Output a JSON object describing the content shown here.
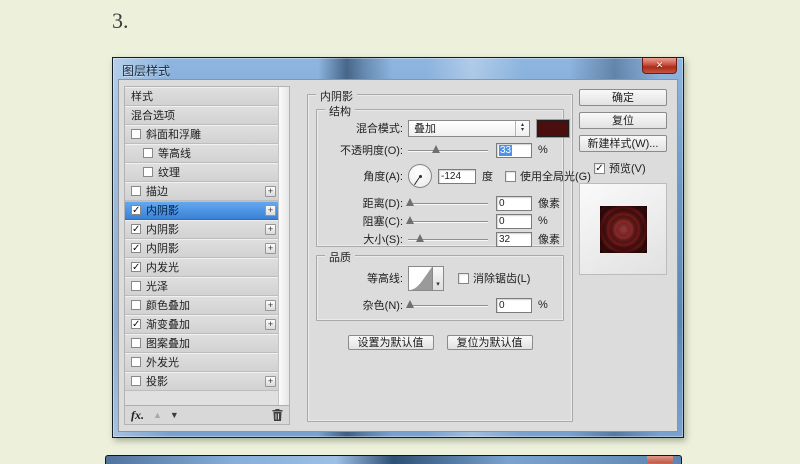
{
  "page": {
    "step_label": "3."
  },
  "icons": {
    "close": "✕",
    "check": "✓",
    "plus": "+",
    "up_arrow": "▲",
    "down_arrow": "▼",
    "spin_up": "▴",
    "spin_down": "▾",
    "dropdown_arrow": "▾",
    "fx": "fx."
  },
  "colors": {
    "selection_blue": "#3a80d6",
    "blend_swatch": "#4b0e0e",
    "preview_red": "#4a0d0d"
  },
  "dialog": {
    "title": "图层样式"
  },
  "sidebar": {
    "items": [
      {
        "label": "样式",
        "type": "plain"
      },
      {
        "label": "混合选项",
        "type": "plain"
      },
      {
        "label": "斜面和浮雕",
        "checked": false
      },
      {
        "label": "等高线",
        "checked": false,
        "indent": true
      },
      {
        "label": "纹理",
        "checked": false,
        "indent": true
      },
      {
        "label": "描边",
        "checked": false,
        "plus": true
      },
      {
        "label": "内阴影",
        "checked": true,
        "plus": true,
        "selected": true
      },
      {
        "label": "内阴影",
        "checked": true,
        "plus": true
      },
      {
        "label": "内阴影",
        "checked": true,
        "plus": true
      },
      {
        "label": "内发光",
        "checked": true
      },
      {
        "label": "光泽",
        "checked": false
      },
      {
        "label": "颜色叠加",
        "checked": false,
        "plus": true
      },
      {
        "label": "渐变叠加",
        "checked": true,
        "plus": true
      },
      {
        "label": "图案叠加",
        "checked": false
      },
      {
        "label": "外发光",
        "checked": false
      },
      {
        "label": "投影",
        "checked": false,
        "plus": true
      }
    ]
  },
  "main": {
    "section_title": "内阴影",
    "structure": {
      "title": "结构",
      "blend_mode": {
        "label": "混合模式:",
        "value": "叠加"
      },
      "opacity": {
        "label": "不透明度(O):",
        "value": "33",
        "unit": "%",
        "slider_pct": 35,
        "value_selected": true
      },
      "angle": {
        "label": "角度(A):",
        "value": "-124",
        "unit": "度",
        "use_global_label": "使用全局光(G)",
        "use_global_checked": false
      },
      "distance": {
        "label": "距离(D):",
        "value": "0",
        "unit": "像素",
        "slider_pct": 2
      },
      "choke": {
        "label": "阻塞(C):",
        "value": "0",
        "unit": "%",
        "slider_pct": 2
      },
      "size": {
        "label": "大小(S):",
        "value": "32",
        "unit": "像素",
        "slider_pct": 15
      }
    },
    "quality": {
      "title": "品质",
      "contour_label": "等高线:",
      "antialias_label": "消除锯齿(L)",
      "antialias_checked": false,
      "noise": {
        "label": "杂色(N):",
        "value": "0",
        "unit": "%",
        "slider_pct": 2
      }
    },
    "buttons": {
      "make_default": "设置为默认值",
      "reset_default": "复位为默认值"
    }
  },
  "actions": {
    "ok": "确定",
    "reset": "复位",
    "new_style": "新建样式(W)...",
    "preview_label": "预览(V)",
    "preview_checked": true
  }
}
